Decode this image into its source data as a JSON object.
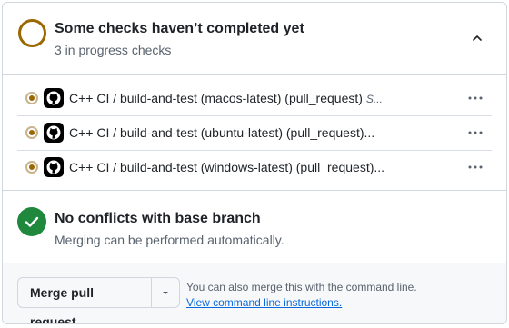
{
  "checks_header": {
    "title": "Some checks haven’t completed yet",
    "subtitle": "3 in progress checks",
    "status_color": "#9a6700",
    "collapse_icon": "chevron-up-icon"
  },
  "checks": [
    {
      "name": "C++ CI / build-and-test (macos-latest) (pull_request)",
      "status": "S...",
      "icon": "github-logo"
    },
    {
      "name": "C++ CI / build-and-test (ubuntu-latest) (pull_request)...",
      "status": "",
      "icon": "github-logo"
    },
    {
      "name": "C++ CI / build-and-test (windows-latest) (pull_request)...",
      "status": "",
      "icon": "github-logo"
    }
  ],
  "conflicts": {
    "title": "No conflicts with base branch",
    "subtitle": "Merging can be performed automatically.",
    "status_color": "#1f883d"
  },
  "merge": {
    "button_label": "Merge pull request",
    "hint": "You can also merge this with the command line.",
    "link": "View command line instructions."
  },
  "colors": {
    "link": "#0969da",
    "pending": "#9a6700",
    "success": "#1f883d"
  }
}
